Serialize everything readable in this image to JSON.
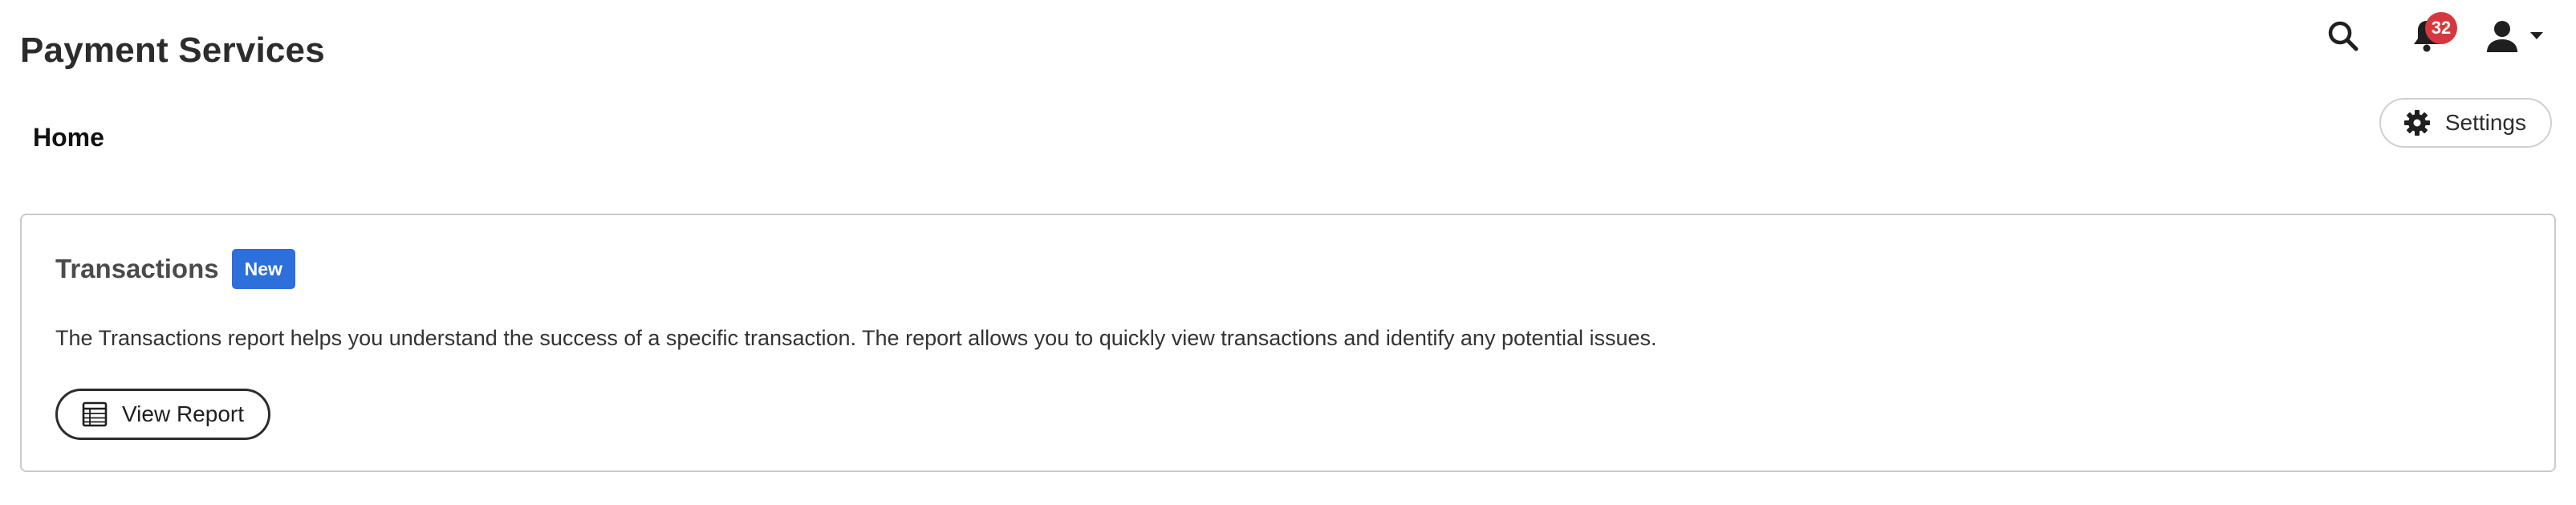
{
  "header": {
    "app_title": "Payment Services",
    "notifications": {
      "count": "32",
      "icon": "bell-icon"
    },
    "search": {
      "icon": "search-icon"
    },
    "user": {
      "icon": "user-icon",
      "caret_icon": "chevron-down-icon"
    }
  },
  "nav": {
    "current_page": "Home",
    "settings": {
      "label": "Settings",
      "icon": "gear-icon"
    }
  },
  "card": {
    "title": "Transactions",
    "badge": "New",
    "description": "The Transactions report helps you understand the success of a specific transaction. The report allows you to quickly view transactions and identify any potential issues.",
    "action": {
      "label": "View Report",
      "icon": "table-icon"
    }
  },
  "colors": {
    "badge_new": "#2d6fdb",
    "notification_badge": "#d7373f",
    "text_primary": "#2c2c2c",
    "border": "#cacaca"
  }
}
